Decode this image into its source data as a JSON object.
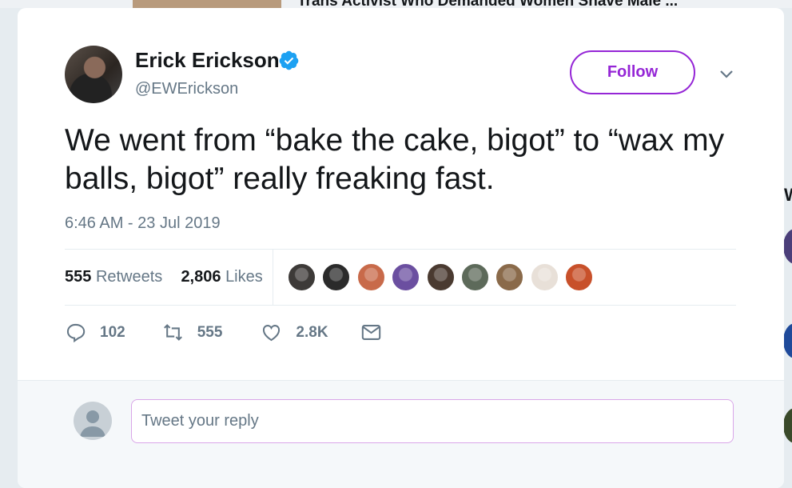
{
  "background": {
    "headline": "Trans Activist Who Demanded Women Shave Male ...",
    "side_letter": "W"
  },
  "tweet": {
    "author_name": "Erick Erickson",
    "handle": "@EWErickson",
    "verified_icon": "verified-badge-icon",
    "follow_label": "Follow",
    "text": "We went from “bake the cake, bigot” to “wax my balls, bigot” really freaking fast.",
    "timestamp": "6:46 AM - 23 Jul 2019",
    "stats": {
      "retweets_count": "555",
      "retweets_label": "Retweets",
      "likes_count": "2,806",
      "likes_label": "Likes"
    },
    "liker_avatars": [
      "#3d3a38",
      "#2b2b2b",
      "#c86a4a",
      "#6b4fa0",
      "#4a3a30",
      "#5d6a5a",
      "#8a6a4a",
      "#e8e0d8",
      "#c8502a"
    ],
    "actions": {
      "reply_count": "102",
      "retweet_count": "555",
      "like_count": "2.8K"
    }
  },
  "reply": {
    "placeholder": "Tweet your reply"
  },
  "colors": {
    "accent": "#9526d6",
    "verified": "#1da1f2",
    "secondary_text": "#657786"
  }
}
